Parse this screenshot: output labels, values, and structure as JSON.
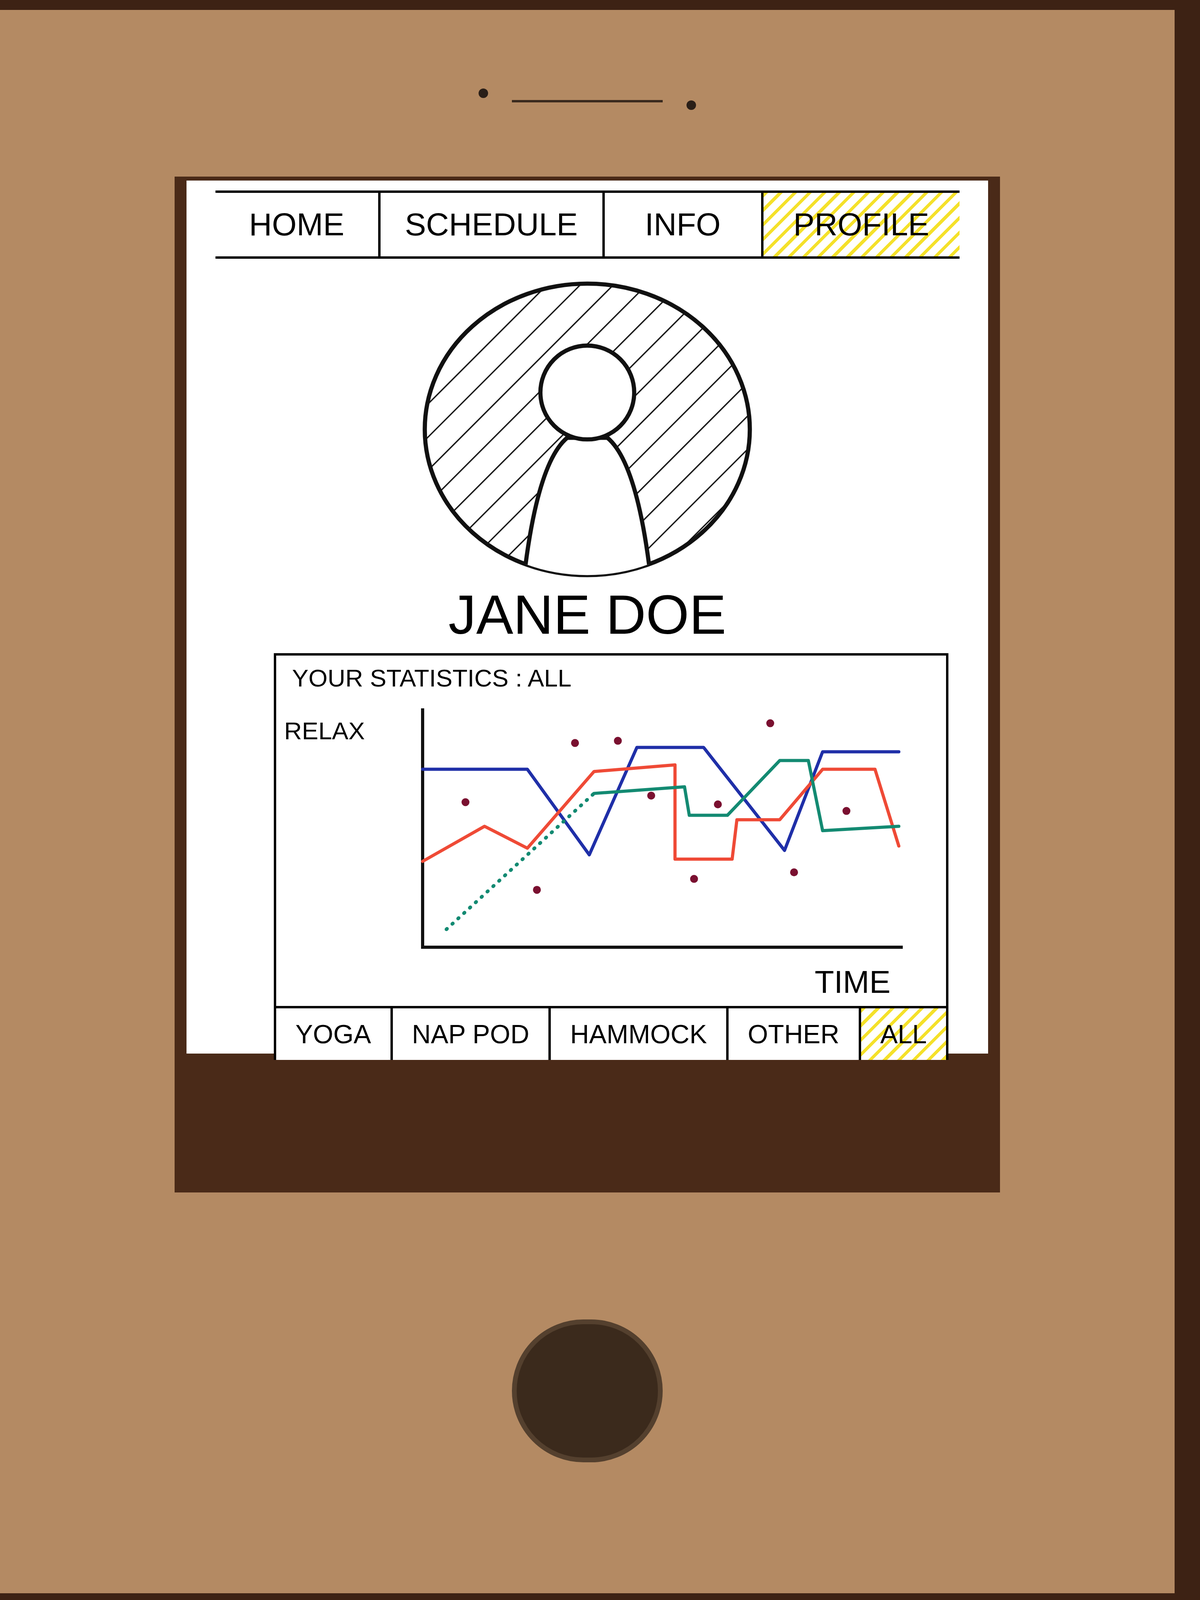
{
  "nav_tabs": [
    {
      "label": "HOME",
      "selected": false
    },
    {
      "label": "SCHEDULE",
      "selected": false
    },
    {
      "label": "INFO",
      "selected": false
    },
    {
      "label": "PROFILE",
      "selected": true
    }
  ],
  "profile": {
    "name": "JANE DOE"
  },
  "statistics": {
    "title": "YOUR STATISTICS : ALL",
    "y_axis_label": "RELAX",
    "x_axis_label": "TIME",
    "series": [
      {
        "name": "blue",
        "kind": "line",
        "color": "#1f2fa8",
        "times": [
          0,
          2.2,
          3.5,
          4.5,
          5.9,
          7.6,
          8.4,
          10
        ],
        "values": [
          7.9,
          7.9,
          4.0,
          8.9,
          8.9,
          4.2,
          8.7,
          8.7
        ]
      },
      {
        "name": "red",
        "kind": "line",
        "color": "#ef4a36",
        "times": [
          0,
          1.3,
          2.2,
          3.6,
          5.3,
          5.3,
          6.5,
          6.6,
          7.5,
          8.4,
          9.5,
          10
        ],
        "values": [
          3.7,
          5.3,
          4.3,
          7.8,
          8.1,
          3.8,
          3.8,
          5.6,
          5.6,
          7.9,
          7.9,
          4.4
        ]
      },
      {
        "name": "green-projected",
        "kind": "dotted",
        "color": "#138a72",
        "times": [
          0.5,
          3.6
        ],
        "values": [
          0.6,
          6.8
        ]
      },
      {
        "name": "green",
        "kind": "line",
        "color": "#138a72",
        "times": [
          3.6,
          5.5,
          5.6,
          6.4,
          7.5,
          8.1,
          8.4,
          10
        ],
        "values": [
          6.8,
          7.1,
          5.8,
          5.8,
          8.3,
          8.3,
          5.1,
          5.3
        ]
      },
      {
        "name": "sessions",
        "kind": "dots",
        "color": "#7a1030",
        "times": [
          0.9,
          3.2,
          4.1,
          4.8,
          2.4,
          5.7,
          6.2,
          7.3,
          7.8,
          8.9
        ],
        "values": [
          6.4,
          9.1,
          9.2,
          6.7,
          2.4,
          2.9,
          6.3,
          10.0,
          3.2,
          6.0
        ]
      }
    ],
    "filter_tabs": [
      {
        "label": "YOGA",
        "selected": false
      },
      {
        "label": "NAP POD",
        "selected": false
      },
      {
        "label": "HAMMOCK",
        "selected": false
      },
      {
        "label": "OTHER",
        "selected": false
      },
      {
        "label": "ALL",
        "selected": true
      }
    ]
  }
}
